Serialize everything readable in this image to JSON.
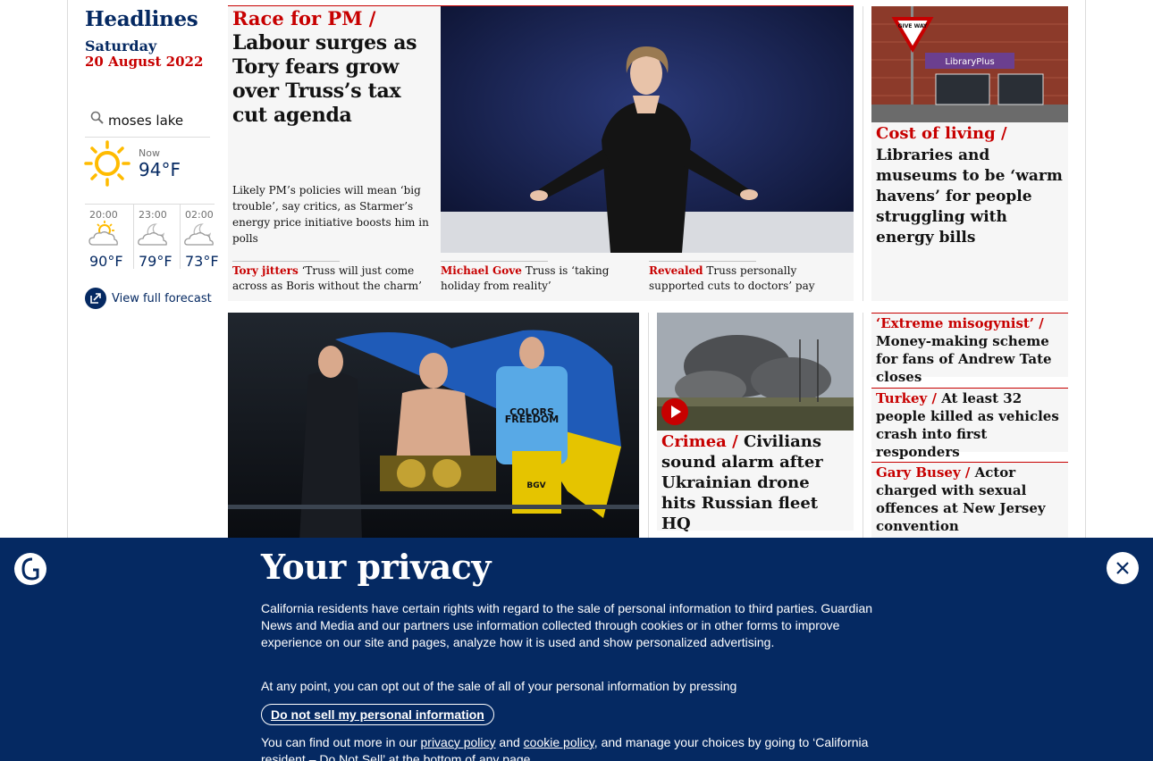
{
  "sidebar": {
    "title": "Headlines",
    "day": "Saturday",
    "date": "20 August 2022",
    "search_value": "moses lake",
    "now": {
      "label": "Now",
      "temp": "94°F",
      "icon": "sun-icon"
    },
    "forecast": [
      {
        "time": "20:00",
        "temp": "90°F",
        "icon": "sun-cloud-icon"
      },
      {
        "time": "23:00",
        "temp": "79°F",
        "icon": "moon-cloud-icon"
      },
      {
        "time": "02:00",
        "temp": "73°F",
        "icon": "moon-cloud-icon"
      }
    ],
    "full_forecast": "View full forecast"
  },
  "lead": {
    "kicker": "Race for PM /",
    "headline": "Labour surges as Tory fears grow over Truss’s tax cut agenda",
    "standfirst": "Likely PM’s policies will mean ‘big trouble’, say critics, as Starmer’s energy price initiative boosts him in polls",
    "sublinks": [
      {
        "kicker": "Tory jitters",
        "text": "‘Truss will just come across as Boris without the charm’"
      },
      {
        "kicker": "Michael Gove",
        "text": "Truss is ‘taking holiday from reality’"
      },
      {
        "kicker": "Revealed",
        "text": "Truss personally supported cuts to doctors’ pay"
      }
    ]
  },
  "right_lead": {
    "kicker": "Cost of living /",
    "headline": "Libraries and museums to be ‘warm havens’ for people struggling with energy bills",
    "image_sign": "LibraryPlus",
    "road_sign": "GIVE WAY"
  },
  "crimea": {
    "kicker": "Crimea /",
    "headline": "Civilians sound alarm after Ukrainian drone hits Russian fleet HQ"
  },
  "boxing_image": {
    "shirt_text": "FREEDOM",
    "shirt_top": "COLORS",
    "short_text": "BGV"
  },
  "minis": [
    {
      "kicker": "‘Extreme misogynist’ /",
      "headline": "Money-making scheme for fans of Andrew Tate closes"
    },
    {
      "kicker": "Turkey /",
      "headline": "At least 32 people killed as vehicles crash into first responders"
    },
    {
      "kicker": "Gary Busey /",
      "headline": "Actor charged with sexual offences at New Jersey convention"
    }
  ],
  "privacy": {
    "title": "Your privacy",
    "p1": "California residents have certain rights with regard to the sale of personal information to third parties. Guardian News and Media and our partners use information collected through cookies or in other forms to improve experience on our site and pages, analyze how it is used and show personalized advertising.",
    "p2": "At any point, you can opt out of the sale of all of your personal information by pressing",
    "button": "Do not sell my personal information",
    "p3_start": "You can find out more in our",
    "privacy_link": "privacy policy",
    "and": "and",
    "cookie_link": "cookie policy",
    "p3_end": ", and manage your choices by going to ‘California resident – Do Not Sell’ at the bottom of any page."
  },
  "colors": {
    "brand": "#052962",
    "news_red": "#c70000",
    "card_bg": "#f6f6f6"
  }
}
